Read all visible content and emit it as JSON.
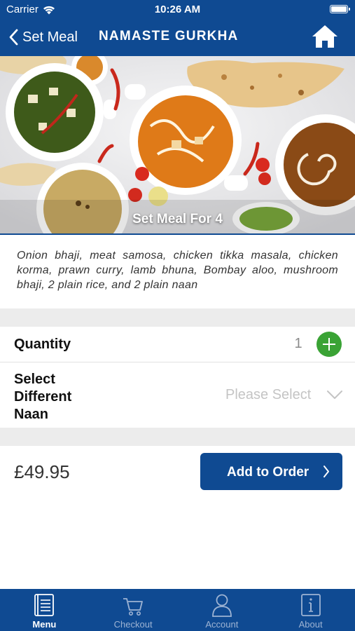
{
  "status_bar": {
    "carrier": "Carrier",
    "time": "10:26 AM"
  },
  "nav": {
    "back_label": "Set Meal",
    "title": "NAMASTE GURKHA",
    "home_icon": "home-icon"
  },
  "hero": {
    "caption": "Set Meal For 4"
  },
  "description": "Onion bhaji, meat samosa, chicken tikka masala, chicken korma, prawn curry, lamb bhuna, Bombay aloo, mushroom bhaji, 2 plain rice, and 2 plain naan",
  "quantity": {
    "label": "Quantity",
    "value": "1"
  },
  "naan_select": {
    "label": "Select Different Naan",
    "placeholder": "Please Select"
  },
  "order": {
    "price": "£49.95",
    "add_button_label": "Add to Order"
  },
  "tabs": [
    {
      "label": "Menu",
      "icon": "menu-book-icon",
      "active": true
    },
    {
      "label": "Checkout",
      "icon": "cart-icon",
      "active": false
    },
    {
      "label": "Account",
      "icon": "person-icon",
      "active": false
    },
    {
      "label": "About",
      "icon": "info-icon",
      "active": false
    }
  ],
  "colors": {
    "brand_blue": "#0f4a92",
    "plus_green": "#3aa335",
    "section_gap": "#ececec",
    "placeholder_gray": "#c4c4c4"
  }
}
